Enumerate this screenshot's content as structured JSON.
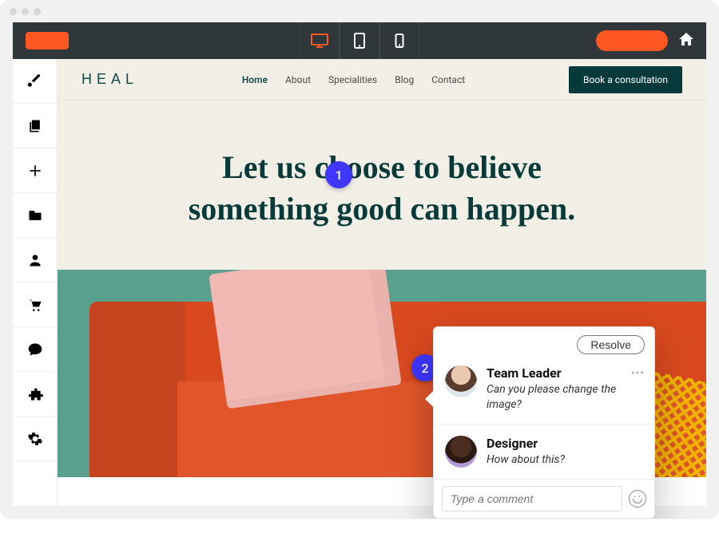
{
  "site": {
    "brand": "HEAL",
    "nav": {
      "home": "Home",
      "about": "About",
      "specialities": "Specialities",
      "blog": "Blog",
      "contact": "Contact"
    },
    "cta": "Book a consultation",
    "hero_line1": "Let us choose to believe",
    "hero_line2": "something good can happen."
  },
  "annotations": {
    "b1": "1",
    "b2": "2"
  },
  "popover": {
    "resolve": "Resolve",
    "comments": [
      {
        "name": "Team Leader",
        "text": "Can you please change the image?"
      },
      {
        "name": "Designer",
        "text": "How about this?"
      }
    ],
    "input_placeholder": "Type a comment"
  }
}
